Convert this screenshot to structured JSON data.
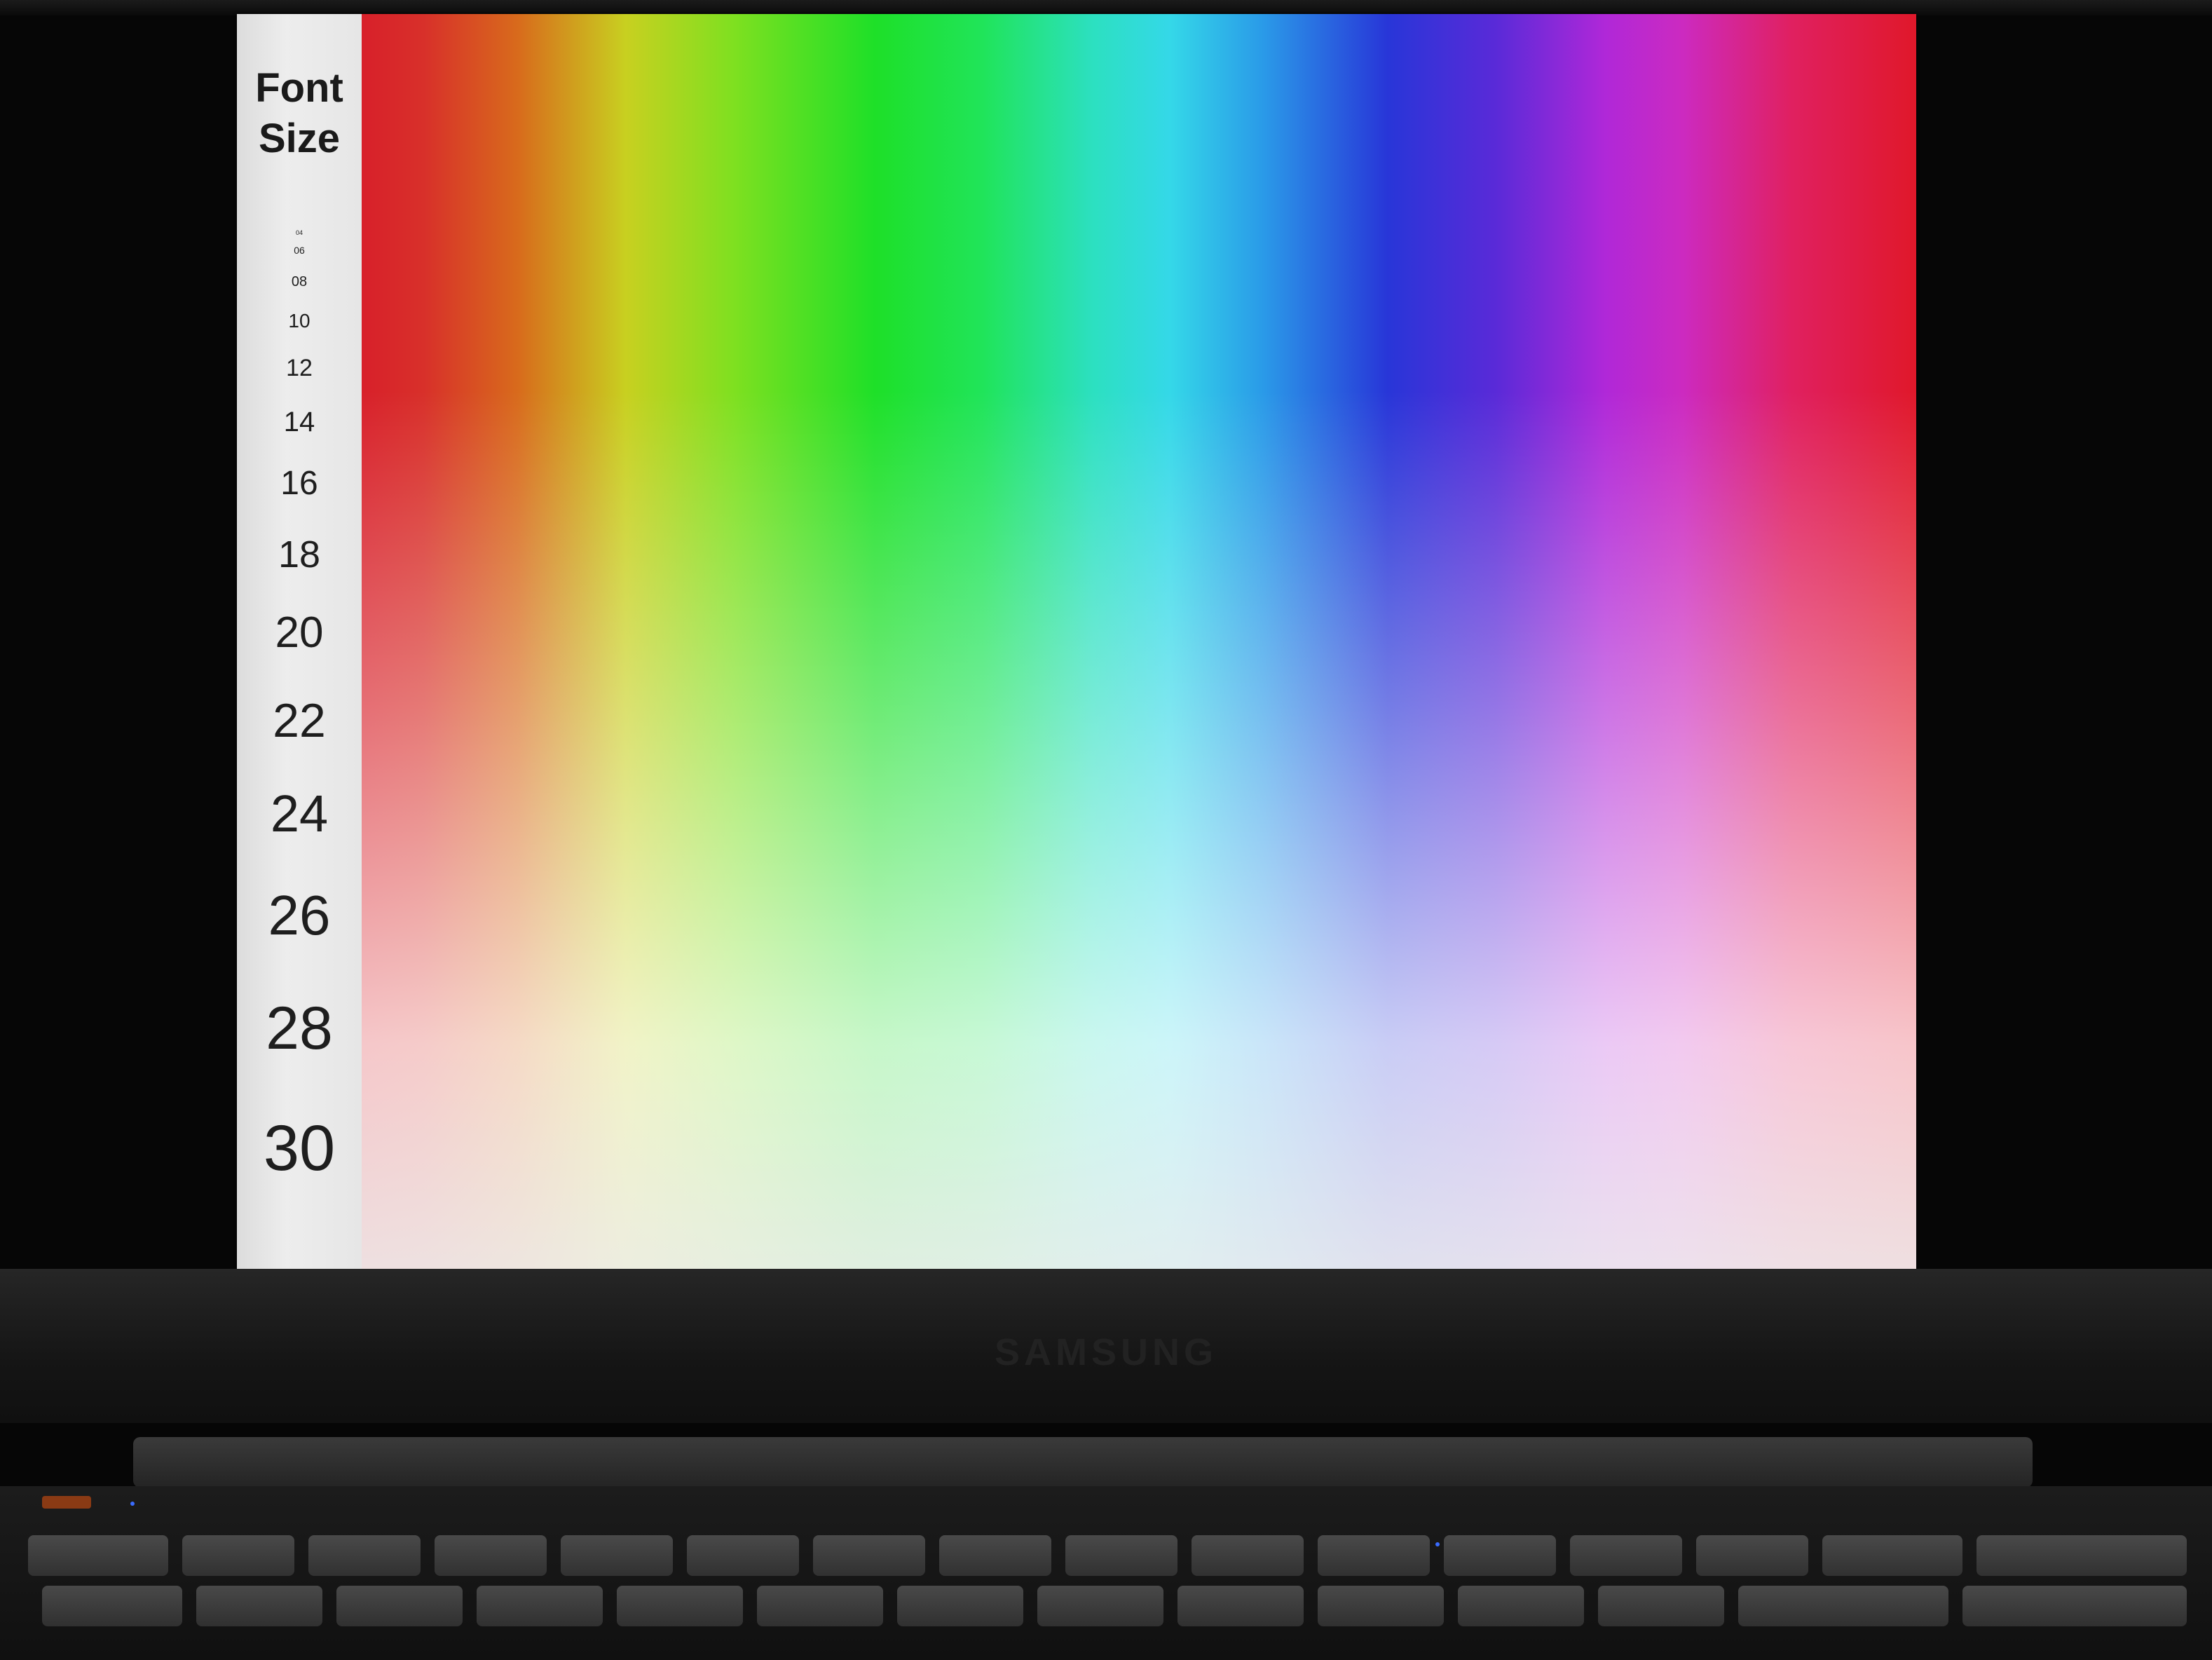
{
  "sidebar": {
    "title_line1": "Font",
    "title_line2": "Size",
    "sizes": [
      "04",
      "06",
      "08",
      "10",
      "12",
      "14",
      "16",
      "18",
      "20",
      "22",
      "24",
      "26",
      "28",
      "30"
    ]
  },
  "laptop": {
    "brand": "SAMSUNG"
  },
  "colors": {
    "spectrum_start": "#d8202a",
    "spectrum_green": "#1ee028",
    "spectrum_cyan": "#34d8e8",
    "spectrum_blue": "#2836d8",
    "spectrum_magenta": "#cc2ac0",
    "spectrum_end": "#e0182a"
  }
}
